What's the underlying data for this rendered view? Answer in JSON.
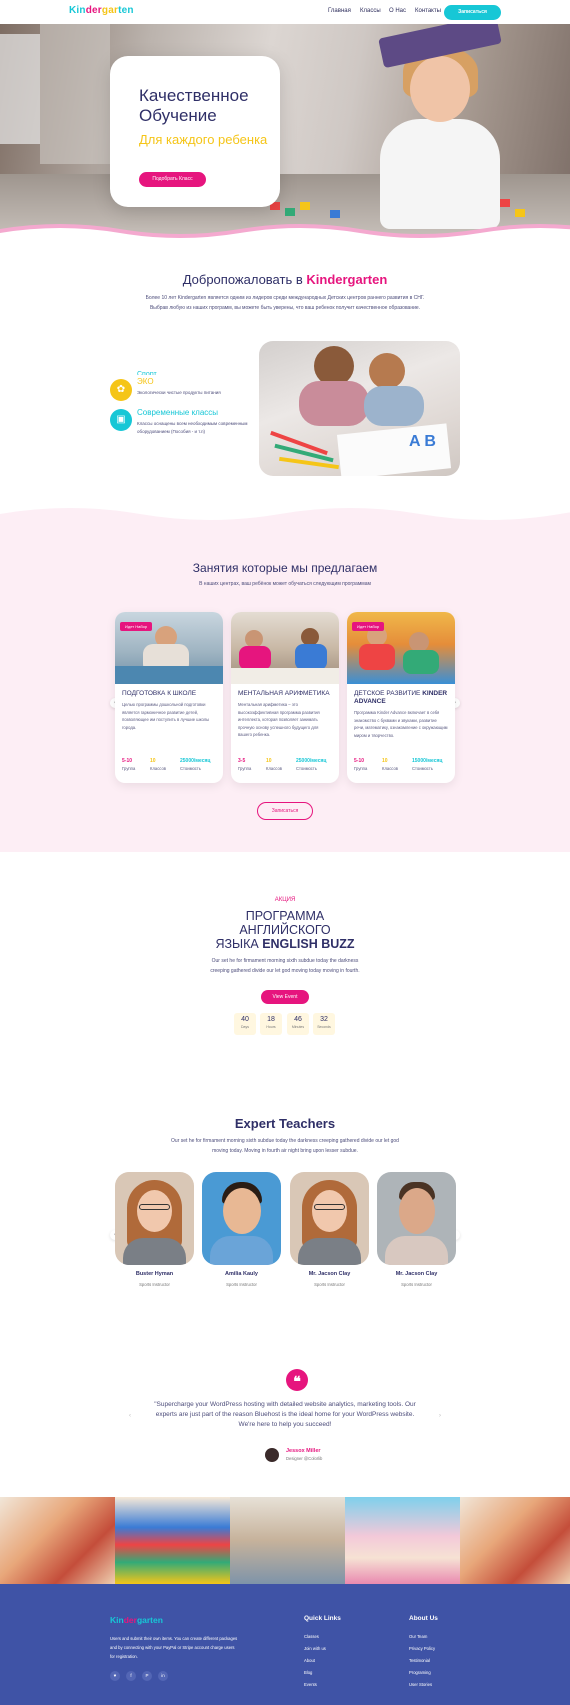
{
  "header": {
    "logo": [
      "Kin",
      "der",
      "gar",
      "ten"
    ],
    "nav": [
      "Главная",
      "Классы",
      "О Нас",
      "Контакты"
    ],
    "enroll_label": "Записаться"
  },
  "hero": {
    "title": "Качественное Обучение",
    "subtitle": "Для каждого ребенка",
    "button": "Подобрать Класс"
  },
  "welcome": {
    "title_prefix": "Добропожаловать в",
    "title_brand": "Kindergarten",
    "text": "Более 10 лет Kindergarten является одним из лидеров среди международных Детских центров раннего развития в СНГ. Выбрав любую из наших программ, вы можете быть уверены, что ваш ребенок получит качественное образование.",
    "features": [
      {
        "title": "Спорт",
        "desc": ""
      },
      {
        "title": "ЭКО",
        "desc": "Экологически чистые продукты питания"
      },
      {
        "title": "Современные классы",
        "desc": "Классы оснащены всем необходимым современным оборудованием (Пособия - и т.п)"
      }
    ]
  },
  "classes": {
    "title": "Занятия которые мы предлагаем",
    "subtitle": "В наших центрах, ваш ребёнок может обучаться следующим программам",
    "cards": [
      {
        "badge": "Идет Набор",
        "title": "ПОДГОТОВКА К ШКОЛЕ",
        "title_bold": "",
        "desc": "Целью программы дошкольной подготовки является гармоничное развитие детей, позволяющее им поступить в лучшие школы города.",
        "stats": [
          {
            "value": "5-10",
            "label": "Группа"
          },
          {
            "value": "10",
            "label": "Классов"
          },
          {
            "value": "25000/месяц",
            "label": "Стоимость"
          }
        ]
      },
      {
        "badge": "",
        "title": "МЕНТАЛЬНАЯ АРИФМЕТИКА",
        "title_bold": "",
        "desc": "Ментальная арифметика – это высокоэффективная программа развития интеллекта, которая позволяет занимать прочную основу успешного будущего для вашего ребенка.",
        "stats": [
          {
            "value": "3-5",
            "label": "Группа"
          },
          {
            "value": "10",
            "label": "Классов"
          },
          {
            "value": "25000/месяц",
            "label": "Стоимость"
          }
        ]
      },
      {
        "badge": "Идет Набор",
        "title": "ДЕТСКОЕ РАЗВИТИЕ",
        "title_bold": "KINDER ADVANCE",
        "desc": "Программа Kinder Advance включает в себя знакомство с буквами и звуками, развитие речи, математику, ознакомление с окружающим миром и творчество.",
        "stats": [
          {
            "value": "5-10",
            "label": "Группа"
          },
          {
            "value": "10",
            "label": "Классов"
          },
          {
            "value": "15000/месяц",
            "label": "Стоимость"
          }
        ]
      }
    ],
    "button": "Записаться"
  },
  "promo": {
    "tag": "АКЦИЯ",
    "title_line1": "ПРОГРАММА",
    "title_line2": "АНГЛИЙСКОГО",
    "title_line3_prefix": "ЯЗЫКА",
    "title_line3_bold": "ENGLISH BUZZ",
    "text": "Our set he for firmament morning sixth subdue today the darkness creeping gathered divide our let god moving today moving in fourth.",
    "button": "View Event",
    "countdown": [
      {
        "value": "40",
        "unit": "Days"
      },
      {
        "value": "18",
        "unit": "Hours"
      },
      {
        "value": "46",
        "unit": "Minutes"
      },
      {
        "value": "32",
        "unit": "Seconds"
      }
    ]
  },
  "teachers": {
    "title": "Expert Teachers",
    "text": "Our set he for firmament morning sixth subdue today the darkness creeping gathered divide our let god moving today. Moving in fourth air night bring upon lesser subdue.",
    "list": [
      {
        "name": "Buster Hyman",
        "role": "Sports Instructor"
      },
      {
        "name": "Amilia Kauly",
        "role": "Sports Instructor"
      },
      {
        "name": "Mr. Jacson Clay",
        "role": "Sports Instructor"
      },
      {
        "name": "Mr. Jacson Clay",
        "role": "Sports Instructor"
      }
    ]
  },
  "testimonial": {
    "quote": "\"Supercharge your WordPress hosting with detailed website analytics, marketing tools. Our experts are just part of the reason Bluehost is the ideal home for your WordPress website. We're here to help you succeed!",
    "name": "Jessox Miller",
    "role": "Designer @Colorlib"
  },
  "footer": {
    "logo": [
      "Kin",
      "der",
      "garten"
    ],
    "text": "Users and submit their own items. You can create different packages and by connecting with your PayPal or Stripe account charge users for registration.",
    "social": [
      "♥",
      "f",
      "P",
      "in"
    ],
    "quick_links_title": "Quick Links",
    "quick_links": [
      "Classes",
      "Join with us",
      "About",
      "Blog",
      "Events"
    ],
    "about_title": "About Us",
    "about_links": [
      "Our Team",
      "Privacy Policy",
      "Testimonial",
      "Programing",
      "User Stories"
    ]
  },
  "colors": {
    "accent_pink": "#e6157e",
    "accent_cyan": "#17c7d6",
    "accent_yellow": "#f5c518",
    "navy": "#2f2f67",
    "footer_blue": "#3f53a6"
  }
}
